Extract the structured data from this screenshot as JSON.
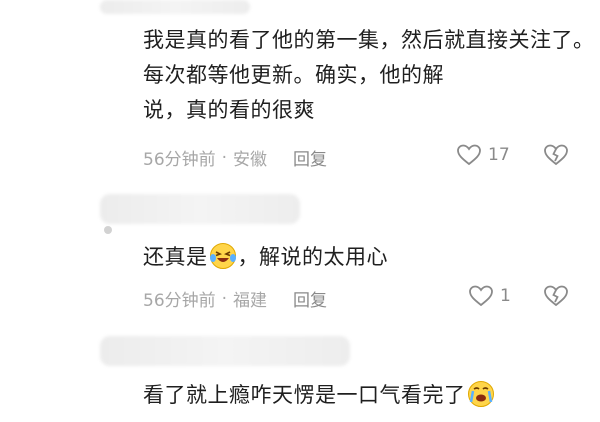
{
  "comments": [
    {
      "text": "我是真的看了他的第一集，然后就直接关注了。每次都等他更新。确实，他的解说，真的看的很爽",
      "lines": [
        "我是真的看了他的第一集，然后就直接关注了。",
        "每次都等他更新。确实，他的解",
        "说，真的看的很爽"
      ],
      "time": "56分钟前",
      "location": "安徽",
      "reply_label": "回复",
      "likes": "17"
    },
    {
      "text_before_emoji": "还真是",
      "emoji": "laughing-crying-emoji",
      "text_after_emoji": "，解说的太用心",
      "time": "56分钟前",
      "location": "福建",
      "reply_label": "回复",
      "likes": "1"
    },
    {
      "text_before_emoji": "看了就上瘾咋天愣是一口气看完了",
      "emoji": "crying-emoji"
    }
  ],
  "separator": "·",
  "icons": {
    "like": "heart-outline-icon",
    "dislike": "broken-heart-icon"
  }
}
